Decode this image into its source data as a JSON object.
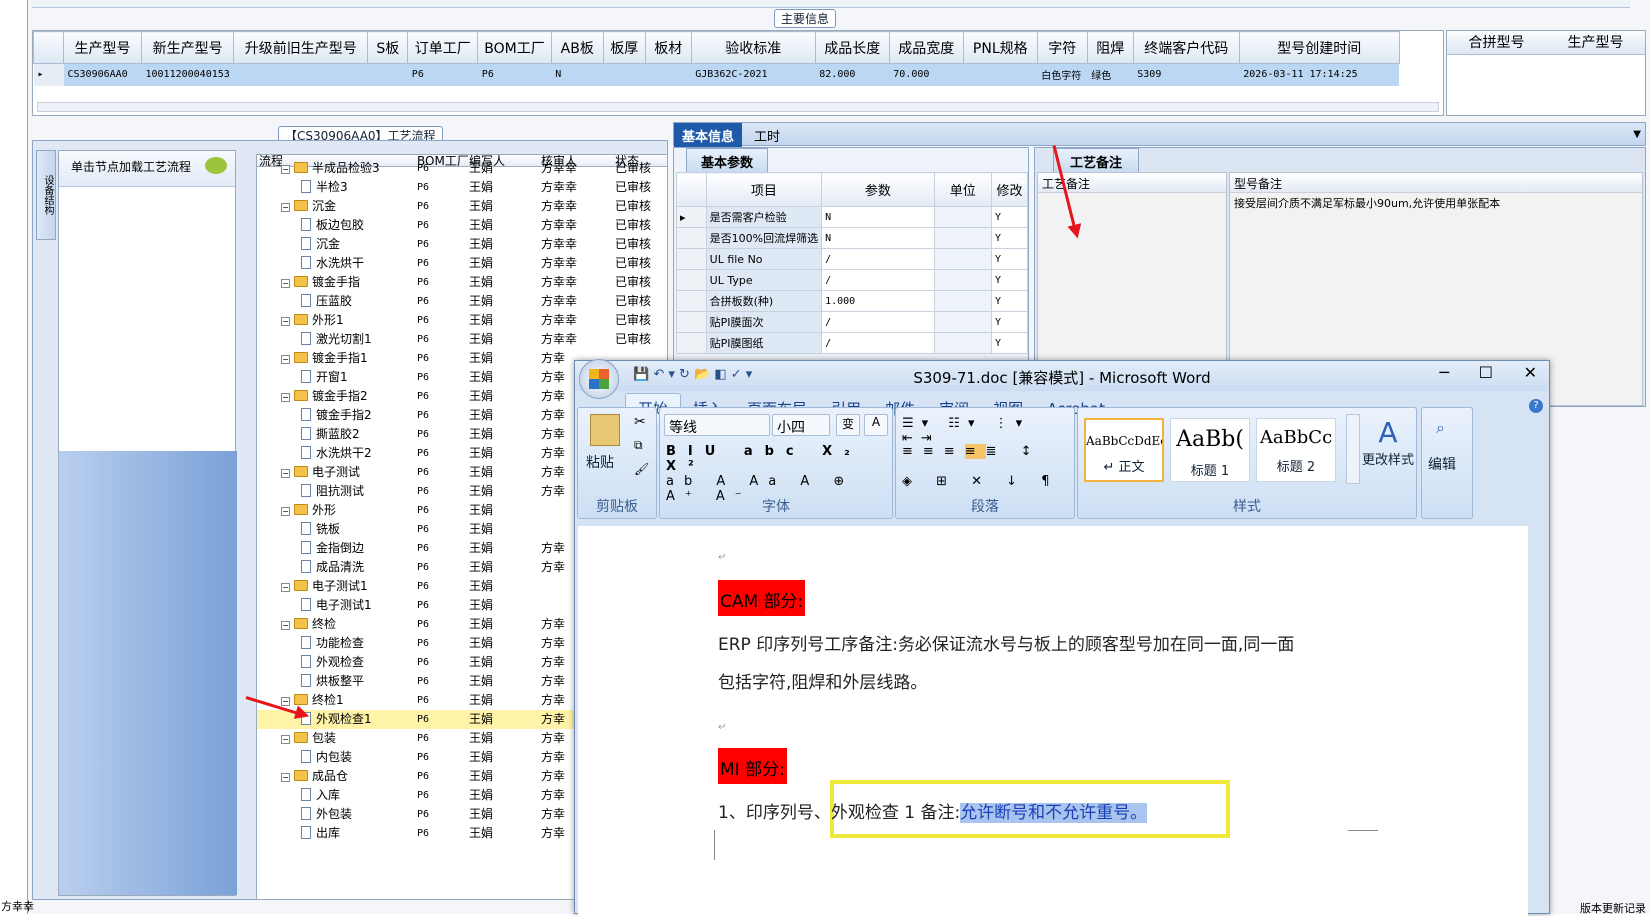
{
  "main_info": {
    "caption": "主要信息",
    "columns": [
      "生产型号",
      "新生产型号",
      "升级前旧生产型号",
      "S板",
      "订单工厂",
      "BOM工厂",
      "AB板",
      "板厚",
      "板材",
      "验收标准",
      "成品长度",
      "成品宽度",
      "PNL规格",
      "字符",
      "阻焊",
      "终端客户代码",
      "型号创建时间"
    ],
    "row": {
      "prod_model": "CS30906AA0",
      "new_model": "10011200040153",
      "order_factory": "P6",
      "bom_factory": "P6",
      "ab": "N",
      "standard": "GJB362C-2021",
      "length": "82.000",
      "width": "70.000",
      "char": "白色字符",
      "mask": "绿色",
      "cust": "S309",
      "created": "2026-03-11 17:14:25"
    },
    "merge_columns": [
      "合拼型号",
      "生产型号"
    ]
  },
  "flow_panel": {
    "title": "【CS30906AA0】工艺流程",
    "side_tab": "设备结构",
    "hint": "单击节点加载工艺流程",
    "columns": [
      "流程",
      "BOM工厂",
      "编写人",
      "核审人",
      "状态"
    ],
    "rows": [
      {
        "label": "半成品检验3",
        "type": "folder",
        "factory": "P6",
        "writer": "王娟",
        "checker": "方幸幸",
        "status": "已审核"
      },
      {
        "label": "半检3",
        "type": "doc",
        "factory": "P6",
        "writer": "王娟",
        "checker": "方幸幸",
        "status": "已审核"
      },
      {
        "label": "沉金",
        "type": "folder",
        "factory": "P6",
        "writer": "王娟",
        "checker": "方幸幸",
        "status": "已审核"
      },
      {
        "label": "板边包胶",
        "type": "doc",
        "factory": "P6",
        "writer": "王娟",
        "checker": "方幸幸",
        "status": "已审核"
      },
      {
        "label": "沉金",
        "type": "doc",
        "factory": "P6",
        "writer": "王娟",
        "checker": "方幸幸",
        "status": "已审核"
      },
      {
        "label": "水洗烘干",
        "type": "doc",
        "factory": "P6",
        "writer": "王娟",
        "checker": "方幸幸",
        "status": "已审核"
      },
      {
        "label": "镀金手指",
        "type": "folder",
        "factory": "P6",
        "writer": "王娟",
        "checker": "方幸幸",
        "status": "已审核"
      },
      {
        "label": "压蓝胶",
        "type": "doc",
        "factory": "P6",
        "writer": "王娟",
        "checker": "方幸幸",
        "status": "已审核"
      },
      {
        "label": "外形1",
        "type": "folder",
        "factory": "P6",
        "writer": "王娟",
        "checker": "方幸幸",
        "status": "已审核"
      },
      {
        "label": "激光切割1",
        "type": "doc",
        "factory": "P6",
        "writer": "王娟",
        "checker": "方幸幸",
        "status": "已审核"
      },
      {
        "label": "镀金手指1",
        "type": "folder",
        "factory": "P6",
        "writer": "王娟",
        "checker": "方幸",
        "status": ""
      },
      {
        "label": "开窗1",
        "type": "doc",
        "factory": "P6",
        "writer": "王娟",
        "checker": "方幸",
        "status": ""
      },
      {
        "label": "镀金手指2",
        "type": "folder",
        "factory": "P6",
        "writer": "王娟",
        "checker": "方幸",
        "status": ""
      },
      {
        "label": "镀金手指2",
        "type": "doc",
        "factory": "P6",
        "writer": "王娟",
        "checker": "方幸",
        "status": ""
      },
      {
        "label": "撕蓝胶2",
        "type": "doc",
        "factory": "P6",
        "writer": "王娟",
        "checker": "方幸",
        "status": ""
      },
      {
        "label": "水洗烘干2",
        "type": "doc",
        "factory": "P6",
        "writer": "王娟",
        "checker": "方幸",
        "status": ""
      },
      {
        "label": "电子测试",
        "type": "folder",
        "factory": "P6",
        "writer": "王娟",
        "checker": "方幸",
        "status": ""
      },
      {
        "label": "阻抗测试",
        "type": "doc",
        "factory": "P6",
        "writer": "王娟",
        "checker": "方幸",
        "status": ""
      },
      {
        "label": "外形",
        "type": "folder",
        "factory": "P6",
        "writer": "王娟",
        "checker": "",
        "status": ""
      },
      {
        "label": "铣板",
        "type": "doc",
        "factory": "P6",
        "writer": "王娟",
        "checker": "",
        "status": ""
      },
      {
        "label": "金指倒边",
        "type": "doc",
        "factory": "P6",
        "writer": "王娟",
        "checker": "方幸",
        "status": ""
      },
      {
        "label": "成品清洗",
        "type": "doc",
        "factory": "P6",
        "writer": "王娟",
        "checker": "方幸",
        "status": ""
      },
      {
        "label": "电子测试1",
        "type": "folder",
        "factory": "P6",
        "writer": "王娟",
        "checker": "",
        "status": ""
      },
      {
        "label": "电子测试1",
        "type": "doc",
        "factory": "P6",
        "writer": "王娟",
        "checker": "",
        "status": ""
      },
      {
        "label": "终检",
        "type": "folder",
        "factory": "P6",
        "writer": "王娟",
        "checker": "方幸",
        "status": ""
      },
      {
        "label": "功能检查",
        "type": "doc",
        "factory": "P6",
        "writer": "王娟",
        "checker": "方幸",
        "status": ""
      },
      {
        "label": "外观检查",
        "type": "doc",
        "factory": "P6",
        "writer": "王娟",
        "checker": "方幸",
        "status": ""
      },
      {
        "label": "烘板整平",
        "type": "doc",
        "factory": "P6",
        "writer": "王娟",
        "checker": "方幸",
        "status": ""
      },
      {
        "label": "终检1",
        "type": "folder",
        "factory": "P6",
        "writer": "王娟",
        "checker": "方幸",
        "status": ""
      },
      {
        "label": "外观检查1",
        "type": "doc",
        "factory": "P6",
        "writer": "王娟",
        "checker": "方幸",
        "status": "",
        "selected": true
      },
      {
        "label": "包装",
        "type": "folder",
        "factory": "P6",
        "writer": "王娟",
        "checker": "方幸",
        "status": ""
      },
      {
        "label": "内包装",
        "type": "doc",
        "factory": "P6",
        "writer": "王娟",
        "checker": "方幸",
        "status": ""
      },
      {
        "label": "成品仓",
        "type": "folder",
        "factory": "P6",
        "writer": "王娟",
        "checker": "方幸",
        "status": ""
      },
      {
        "label": "入库",
        "type": "doc",
        "factory": "P6",
        "writer": "王娟",
        "checker": "方幸",
        "status": ""
      },
      {
        "label": "外包装",
        "type": "doc",
        "factory": "P6",
        "writer": "王娟",
        "checker": "方幸",
        "status": ""
      },
      {
        "label": "出库",
        "type": "doc",
        "factory": "P6",
        "writer": "王娟",
        "checker": "方幸",
        "status": ""
      }
    ]
  },
  "right_tabs": {
    "basic": "基本信息",
    "hours": "工时",
    "params_tab": "基本参数",
    "remark_tab": "工艺备注"
  },
  "params": {
    "columns": [
      "项目",
      "参数",
      "单位",
      "修改"
    ],
    "rows": [
      {
        "item": "是否需客户检验",
        "value": "N",
        "flag": "Y"
      },
      {
        "item": "是否100%回流焊筛选",
        "value": "N",
        "flag": "Y"
      },
      {
        "item": "UL file No",
        "value": "/",
        "flag": "Y"
      },
      {
        "item": "UL Type",
        "value": "/",
        "flag": "Y"
      },
      {
        "item": "合拼板数(种)",
        "value": "1.000",
        "flag": "Y"
      },
      {
        "item": "贴PI膜面次",
        "value": "/",
        "flag": "Y"
      },
      {
        "item": "贴PI膜图纸",
        "value": "/",
        "flag": "Y"
      }
    ]
  },
  "remarks": {
    "col1": "工艺备注",
    "col2": "型号备注",
    "model_remark": "接受层间介质不满足军标最小90um,允许使用单张配本"
  },
  "status_left": "方幸幸",
  "status_right": "版本更新记录",
  "word": {
    "title": "S309-71.doc [兼容模式] - Microsoft Word",
    "tabs": [
      "开始",
      "插入",
      "页面布局",
      "引用",
      "邮件",
      "审阅",
      "视图",
      "Acrobat"
    ],
    "font_name": "等线",
    "font_size": "小四",
    "groups": {
      "clipboard": "剪贴板",
      "font": "字体",
      "paragraph": "段落",
      "styles": "样式",
      "editing": "编辑"
    },
    "paste": "粘贴",
    "change_styles": "更改样式",
    "edit": "编辑",
    "styles": [
      {
        "preview": "AaBbCcDdEe",
        "name": "↵ 正文"
      },
      {
        "preview": "AaBb(",
        "name": "标题 1"
      },
      {
        "preview": "AaBbCc",
        "name": "标题 2"
      }
    ],
    "doc": {
      "cam_label": "CAM 部分:",
      "cam_line1": "ERP 印序列号工序备注:务必保证流水号与板上的顾客型号加在同一面,同一面",
      "cam_line2": "包括字符,阻焊和外层线路。",
      "mi_label": "MI 部分:",
      "mi_line_prefix": "1、印序列号、外观检查 1 备注:",
      "mi_highlight": "允许断号和不允许重号。"
    }
  },
  "colors": {
    "accent": "#1e5aa8",
    "highlight": "#ffff00",
    "red": "#ff0000",
    "arrow": "#e8141c"
  }
}
